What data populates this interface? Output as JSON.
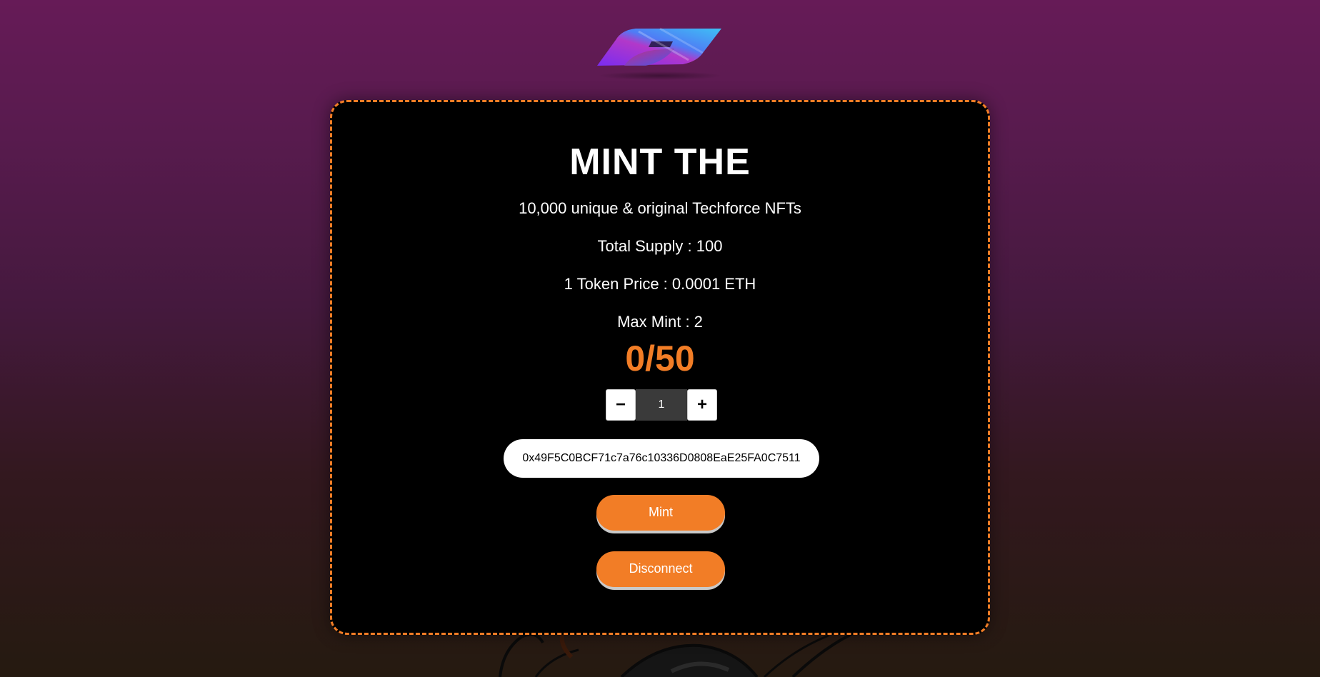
{
  "header": {
    "logo_icon": "stylized-s-logo-icon"
  },
  "mint_card": {
    "title": "MINT THE",
    "description": "10,000 unique & original Techforce NFTs",
    "total_supply": "Total Supply : 100",
    "token_price": "1 Token Price : 0.0001 ETH",
    "max_mint": "Max Mint : 2",
    "counter": "0/50",
    "stepper": {
      "decrement_label": "−",
      "increment_label": "+",
      "quantity": "1"
    },
    "wallet_address": "0x49F5C0BCF71c7a76c10336D0808EaE25FA0C7511",
    "mint_button": "Mint",
    "disconnect_button": "Disconnect"
  },
  "colors": {
    "accent": "#f27d26",
    "card_bg": "#000000",
    "bg_top": "#661b57",
    "bg_bottom": "#251a10"
  }
}
